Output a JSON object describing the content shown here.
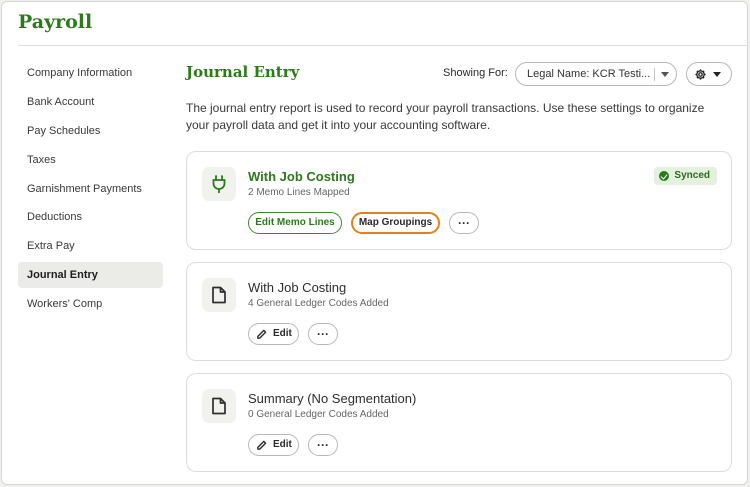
{
  "app": {
    "title": "Payroll"
  },
  "sidebar": {
    "items": [
      {
        "label": "Company Information"
      },
      {
        "label": "Bank Account"
      },
      {
        "label": "Pay Schedules"
      },
      {
        "label": "Taxes"
      },
      {
        "label": "Garnishment Payments"
      },
      {
        "label": "Deductions"
      },
      {
        "label": "Extra Pay"
      },
      {
        "label": "Journal Entry",
        "active": true
      },
      {
        "label": "Workers' Comp"
      }
    ]
  },
  "header": {
    "title": "Journal Entry",
    "showing_for_label": "Showing For:",
    "entity_select": {
      "value": "Legal Name: KCR Testi..."
    },
    "settings_icon": "gear-icon"
  },
  "description": "The journal entry report is used to record your payroll transactions. Use these settings to organize your payroll data and get it into your accounting software.",
  "cards": [
    {
      "icon": "plug-icon",
      "title": "With Job Costing",
      "subtitle": "2 Memo Lines Mapped",
      "status": "Synced",
      "buttons": {
        "edit_memo": "Edit Memo Lines",
        "map_groupings": "Map Groupings",
        "more": "···"
      }
    },
    {
      "icon": "document-icon",
      "title": "With Job Costing",
      "subtitle": "4 General Ledger Codes Added",
      "buttons": {
        "edit": "Edit",
        "more": "···"
      }
    },
    {
      "icon": "document-icon",
      "title": "Summary (No Segmentation)",
      "subtitle": "0 General Ledger Codes Added",
      "buttons": {
        "edit": "Edit",
        "more": "···"
      }
    }
  ],
  "colors": {
    "brand_green": "#2c7a1c",
    "focus_orange": "#e3821c",
    "synced_bg": "#e4f1de"
  }
}
